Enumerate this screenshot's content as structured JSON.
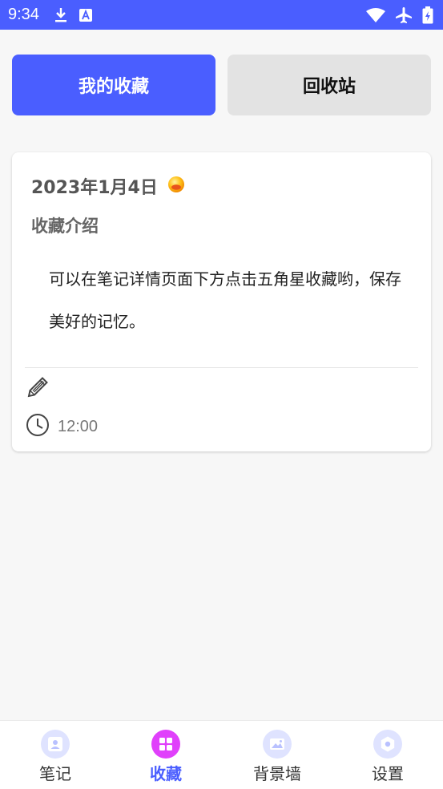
{
  "status_bar": {
    "time": "9:34",
    "icons_left": [
      "download-icon",
      "font-icon"
    ],
    "icons_right": [
      "wifi-icon",
      "airplane-icon",
      "battery-icon"
    ]
  },
  "tabs": [
    {
      "label": "我的收藏",
      "active": true
    },
    {
      "label": "回收站",
      "active": false
    }
  ],
  "card": {
    "date": "2023年1月4日",
    "mood_icon": "mood-emoji-icon",
    "title": "收藏介绍",
    "body": "可以在笔记详情页面下方点击五角星收藏哟，保存美好的记忆。",
    "time": "12:00"
  },
  "bottom_nav": [
    {
      "label": "笔记",
      "icon": "notes-icon",
      "active": false
    },
    {
      "label": "收藏",
      "icon": "favorites-icon",
      "active": true
    },
    {
      "label": "背景墙",
      "icon": "image-icon",
      "active": false
    },
    {
      "label": "设置",
      "icon": "settings-icon",
      "active": false
    }
  ],
  "colors": {
    "primary": "#4a5eff",
    "active_nav_icon": "#e040fb",
    "inactive_nav_icon_bg": "#dfe3ff",
    "inactive_tab": "#e3e3e3"
  }
}
